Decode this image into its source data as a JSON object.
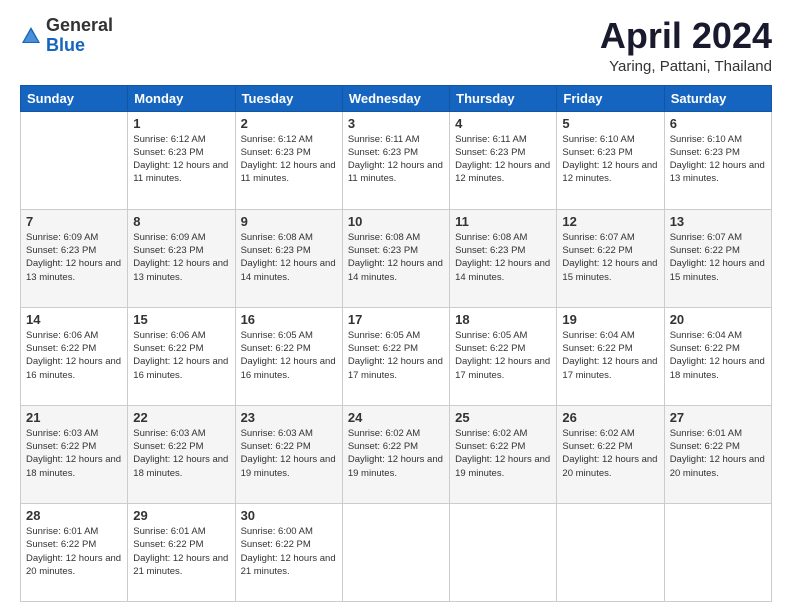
{
  "header": {
    "logo_general": "General",
    "logo_blue": "Blue",
    "month_title": "April 2024",
    "location": "Yaring, Pattani, Thailand"
  },
  "weekdays": [
    "Sunday",
    "Monday",
    "Tuesday",
    "Wednesday",
    "Thursday",
    "Friday",
    "Saturday"
  ],
  "weeks": [
    [
      {
        "day": "",
        "sunrise": "",
        "sunset": "",
        "daylight": ""
      },
      {
        "day": "1",
        "sunrise": "Sunrise: 6:12 AM",
        "sunset": "Sunset: 6:23 PM",
        "daylight": "Daylight: 12 hours and 11 minutes."
      },
      {
        "day": "2",
        "sunrise": "Sunrise: 6:12 AM",
        "sunset": "Sunset: 6:23 PM",
        "daylight": "Daylight: 12 hours and 11 minutes."
      },
      {
        "day": "3",
        "sunrise": "Sunrise: 6:11 AM",
        "sunset": "Sunset: 6:23 PM",
        "daylight": "Daylight: 12 hours and 11 minutes."
      },
      {
        "day": "4",
        "sunrise": "Sunrise: 6:11 AM",
        "sunset": "Sunset: 6:23 PM",
        "daylight": "Daylight: 12 hours and 12 minutes."
      },
      {
        "day": "5",
        "sunrise": "Sunrise: 6:10 AM",
        "sunset": "Sunset: 6:23 PM",
        "daylight": "Daylight: 12 hours and 12 minutes."
      },
      {
        "day": "6",
        "sunrise": "Sunrise: 6:10 AM",
        "sunset": "Sunset: 6:23 PM",
        "daylight": "Daylight: 12 hours and 13 minutes."
      }
    ],
    [
      {
        "day": "7",
        "sunrise": "Sunrise: 6:09 AM",
        "sunset": "Sunset: 6:23 PM",
        "daylight": "Daylight: 12 hours and 13 minutes."
      },
      {
        "day": "8",
        "sunrise": "Sunrise: 6:09 AM",
        "sunset": "Sunset: 6:23 PM",
        "daylight": "Daylight: 12 hours and 13 minutes."
      },
      {
        "day": "9",
        "sunrise": "Sunrise: 6:08 AM",
        "sunset": "Sunset: 6:23 PM",
        "daylight": "Daylight: 12 hours and 14 minutes."
      },
      {
        "day": "10",
        "sunrise": "Sunrise: 6:08 AM",
        "sunset": "Sunset: 6:23 PM",
        "daylight": "Daylight: 12 hours and 14 minutes."
      },
      {
        "day": "11",
        "sunrise": "Sunrise: 6:08 AM",
        "sunset": "Sunset: 6:23 PM",
        "daylight": "Daylight: 12 hours and 14 minutes."
      },
      {
        "day": "12",
        "sunrise": "Sunrise: 6:07 AM",
        "sunset": "Sunset: 6:22 PM",
        "daylight": "Daylight: 12 hours and 15 minutes."
      },
      {
        "day": "13",
        "sunrise": "Sunrise: 6:07 AM",
        "sunset": "Sunset: 6:22 PM",
        "daylight": "Daylight: 12 hours and 15 minutes."
      }
    ],
    [
      {
        "day": "14",
        "sunrise": "Sunrise: 6:06 AM",
        "sunset": "Sunset: 6:22 PM",
        "daylight": "Daylight: 12 hours and 16 minutes."
      },
      {
        "day": "15",
        "sunrise": "Sunrise: 6:06 AM",
        "sunset": "Sunset: 6:22 PM",
        "daylight": "Daylight: 12 hours and 16 minutes."
      },
      {
        "day": "16",
        "sunrise": "Sunrise: 6:05 AM",
        "sunset": "Sunset: 6:22 PM",
        "daylight": "Daylight: 12 hours and 16 minutes."
      },
      {
        "day": "17",
        "sunrise": "Sunrise: 6:05 AM",
        "sunset": "Sunset: 6:22 PM",
        "daylight": "Daylight: 12 hours and 17 minutes."
      },
      {
        "day": "18",
        "sunrise": "Sunrise: 6:05 AM",
        "sunset": "Sunset: 6:22 PM",
        "daylight": "Daylight: 12 hours and 17 minutes."
      },
      {
        "day": "19",
        "sunrise": "Sunrise: 6:04 AM",
        "sunset": "Sunset: 6:22 PM",
        "daylight": "Daylight: 12 hours and 17 minutes."
      },
      {
        "day": "20",
        "sunrise": "Sunrise: 6:04 AM",
        "sunset": "Sunset: 6:22 PM",
        "daylight": "Daylight: 12 hours and 18 minutes."
      }
    ],
    [
      {
        "day": "21",
        "sunrise": "Sunrise: 6:03 AM",
        "sunset": "Sunset: 6:22 PM",
        "daylight": "Daylight: 12 hours and 18 minutes."
      },
      {
        "day": "22",
        "sunrise": "Sunrise: 6:03 AM",
        "sunset": "Sunset: 6:22 PM",
        "daylight": "Daylight: 12 hours and 18 minutes."
      },
      {
        "day": "23",
        "sunrise": "Sunrise: 6:03 AM",
        "sunset": "Sunset: 6:22 PM",
        "daylight": "Daylight: 12 hours and 19 minutes."
      },
      {
        "day": "24",
        "sunrise": "Sunrise: 6:02 AM",
        "sunset": "Sunset: 6:22 PM",
        "daylight": "Daylight: 12 hours and 19 minutes."
      },
      {
        "day": "25",
        "sunrise": "Sunrise: 6:02 AM",
        "sunset": "Sunset: 6:22 PM",
        "daylight": "Daylight: 12 hours and 19 minutes."
      },
      {
        "day": "26",
        "sunrise": "Sunrise: 6:02 AM",
        "sunset": "Sunset: 6:22 PM",
        "daylight": "Daylight: 12 hours and 20 minutes."
      },
      {
        "day": "27",
        "sunrise": "Sunrise: 6:01 AM",
        "sunset": "Sunset: 6:22 PM",
        "daylight": "Daylight: 12 hours and 20 minutes."
      }
    ],
    [
      {
        "day": "28",
        "sunrise": "Sunrise: 6:01 AM",
        "sunset": "Sunset: 6:22 PM",
        "daylight": "Daylight: 12 hours and 20 minutes."
      },
      {
        "day": "29",
        "sunrise": "Sunrise: 6:01 AM",
        "sunset": "Sunset: 6:22 PM",
        "daylight": "Daylight: 12 hours and 21 minutes."
      },
      {
        "day": "30",
        "sunrise": "Sunrise: 6:00 AM",
        "sunset": "Sunset: 6:22 PM",
        "daylight": "Daylight: 12 hours and 21 minutes."
      },
      {
        "day": "",
        "sunrise": "",
        "sunset": "",
        "daylight": ""
      },
      {
        "day": "",
        "sunrise": "",
        "sunset": "",
        "daylight": ""
      },
      {
        "day": "",
        "sunrise": "",
        "sunset": "",
        "daylight": ""
      },
      {
        "day": "",
        "sunrise": "",
        "sunset": "",
        "daylight": ""
      }
    ]
  ]
}
